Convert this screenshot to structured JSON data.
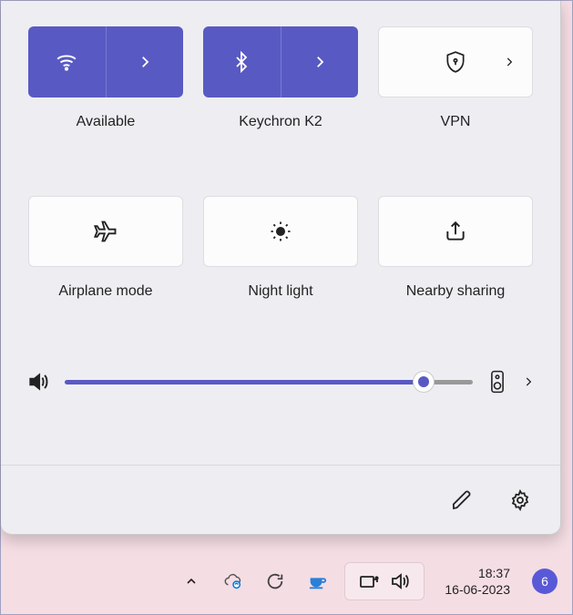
{
  "accent": "#5959c4",
  "tiles": {
    "wifi": {
      "label": "Available",
      "active": true,
      "expandable": true
    },
    "bluetooth": {
      "label": "Keychron K2",
      "active": true,
      "expandable": true
    },
    "vpn": {
      "label": "VPN",
      "active": false,
      "expandable": true
    },
    "airplane": {
      "label": "Airplane mode",
      "active": false
    },
    "nightlight": {
      "label": "Night light",
      "active": false
    },
    "nearby": {
      "label": "Nearby sharing",
      "active": false
    }
  },
  "volume": {
    "percent": 88
  },
  "tray": {
    "time": "18:37",
    "date": "16-06-2023",
    "notification_count": "6"
  }
}
